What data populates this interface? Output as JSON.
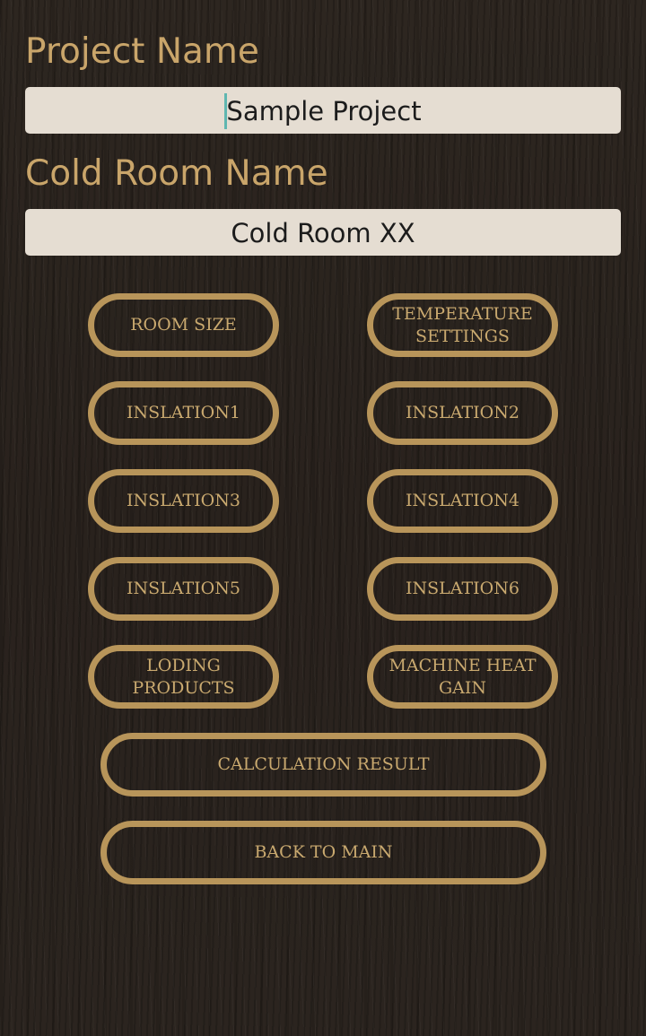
{
  "project": {
    "label": "Project Name",
    "value": "Sample Project"
  },
  "cold_room": {
    "label": "Cold Room Name",
    "value": "Cold Room XX"
  },
  "buttons": {
    "room_size": "ROOM SIZE",
    "temperature_settings": "TEMPERATURE\nSETTINGS",
    "inslation1": "INSLATION1",
    "inslation2": "INSLATION2",
    "inslation3": "INSLATION3",
    "inslation4": "INSLATION4",
    "inslation5": "INSLATION5",
    "inslation6": "INSLATION6",
    "loding_products": "LODING PRODUCTS",
    "machine_heat_gain": "MACHINE HEAT\nGAIN",
    "calculation_result": "CALCULATION RESULT",
    "back_to_main": "BACK TO MAIN"
  },
  "colors": {
    "accent": "#b8955a",
    "label_text": "#c9a56a",
    "field_background": "#e5ddd2",
    "caret": "#5fb6b0"
  }
}
